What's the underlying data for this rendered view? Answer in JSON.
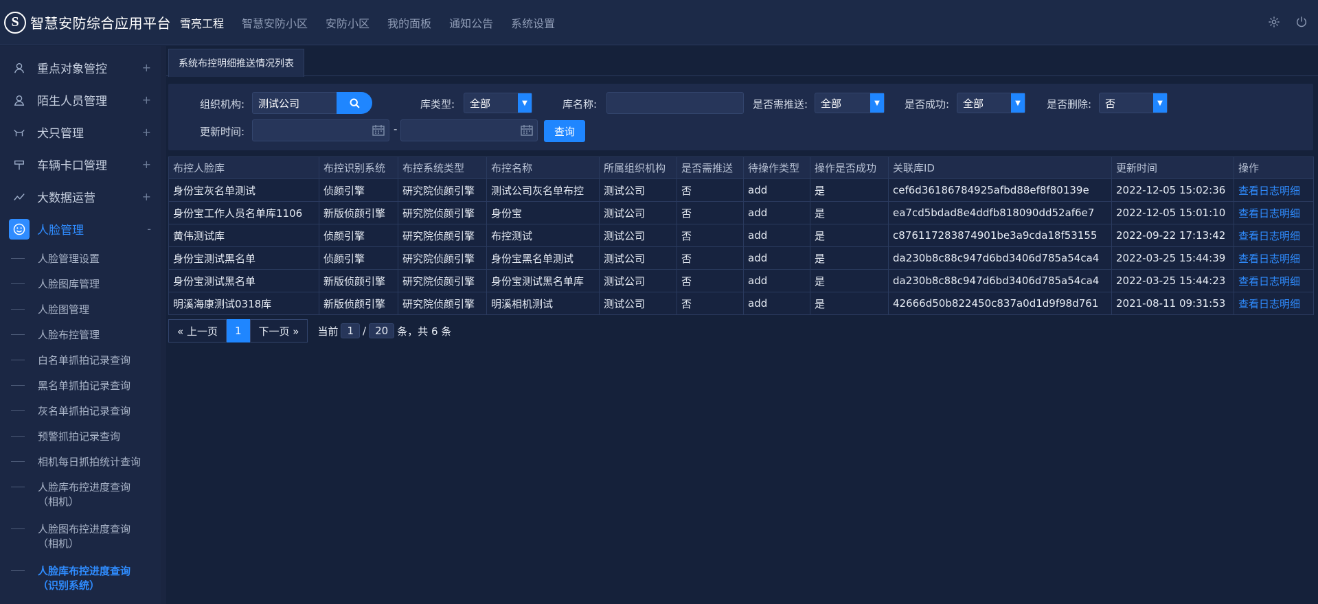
{
  "app": {
    "logo_letter": "S",
    "title": "智慧安防综合应用平台"
  },
  "nav": [
    {
      "label": "雪亮工程",
      "active": true
    },
    {
      "label": "智慧安防小区"
    },
    {
      "label": "安防小区"
    },
    {
      "label": "我的面板"
    },
    {
      "label": "通知公告"
    },
    {
      "label": "系统设置"
    }
  ],
  "top_icons": [
    "gear-icon",
    "power-icon"
  ],
  "sidebar": {
    "items": [
      {
        "label": "重点对象管控",
        "icon": "person-icon",
        "expand": "+"
      },
      {
        "label": "陌生人员管理",
        "icon": "person-outline-icon",
        "expand": "+"
      },
      {
        "label": "犬只管理",
        "icon": "dog-icon",
        "expand": "+"
      },
      {
        "label": "车辆卡口管理",
        "icon": "checkpoint-icon",
        "expand": "+"
      },
      {
        "label": "大数据运营",
        "icon": "trend-icon",
        "expand": "+"
      },
      {
        "label": "人脸管理",
        "icon": "face-icon",
        "expand": "-",
        "active": true
      }
    ],
    "subitems": [
      {
        "label": "人脸管理设置"
      },
      {
        "label": "人脸图库管理"
      },
      {
        "label": "人脸图管理"
      },
      {
        "label": "人脸布控管理"
      },
      {
        "label": "白名单抓拍记录查询"
      },
      {
        "label": "黑名单抓拍记录查询"
      },
      {
        "label": "灰名单抓拍记录查询"
      },
      {
        "label": "预警抓拍记录查询"
      },
      {
        "label": "相机每日抓拍统计查询"
      },
      {
        "label": "人脸库布控进度查询",
        "label2": "（相机）"
      },
      {
        "label": "人脸图布控进度查询",
        "label2": "（相机）"
      },
      {
        "label": "人脸库布控进度查询",
        "label2": "（识别系统）",
        "active": true
      }
    ]
  },
  "tab": {
    "label": "系统布控明细推送情况列表"
  },
  "filters": {
    "org_label": "组织机构:",
    "org_value": "测试公司",
    "lib_type_label": "库类型:",
    "lib_type_value": "全部",
    "lib_name_label": "库名称:",
    "lib_name_value": "",
    "need_push_label": "是否需推送:",
    "need_push_value": "全部",
    "success_label": "是否成功:",
    "success_value": "全部",
    "deleted_label": "是否删除:",
    "deleted_value": "否",
    "update_time_label": "更新时间:",
    "date_sep": "-",
    "query_label": "查询"
  },
  "table": {
    "headers": [
      "布控人脸库",
      "布控识别系统",
      "布控系统类型",
      "布控名称",
      "所属组织机构",
      "是否需推送",
      "待操作类型",
      "操作是否成功",
      "关联库ID",
      "更新时间",
      "操作"
    ],
    "rows": [
      [
        "身份宝灰名单测试",
        "侦颜引擎",
        "研究院侦颜引擎",
        "测试公司灰名单布控",
        "测试公司",
        "否",
        "add",
        "是",
        "cef6d36186784925afbd88ef8f80139e",
        "2022-12-05 15:02:36",
        "查看日志明细"
      ],
      [
        "身份宝工作人员名单库1106",
        "新版侦颜引擎",
        "研究院侦颜引擎",
        "身份宝",
        "测试公司",
        "否",
        "add",
        "是",
        "ea7cd5bdad8e4ddfb818090dd52af6e7",
        "2022-12-05 15:01:10",
        "查看日志明细"
      ],
      [
        "黄伟测试库",
        "侦颜引擎",
        "研究院侦颜引擎",
        "布控测试",
        "测试公司",
        "否",
        "add",
        "是",
        "c876117283874901be3a9cda18f53155",
        "2022-09-22 17:13:42",
        "查看日志明细"
      ],
      [
        "身份宝测试黑名单",
        "侦颜引擎",
        "研究院侦颜引擎",
        "身份宝黑名单测试",
        "测试公司",
        "否",
        "add",
        "是",
        "da230b8c88c947d6bd3406d785a54ca4",
        "2022-03-25 15:44:39",
        "查看日志明细"
      ],
      [
        "身份宝测试黑名单",
        "新版侦颜引擎",
        "研究院侦颜引擎",
        "身份宝测试黑名单库",
        "测试公司",
        "否",
        "add",
        "是",
        "da230b8c88c947d6bd3406d785a54ca4",
        "2022-03-25 15:44:23",
        "查看日志明细"
      ],
      [
        "明溪海康测试0318库",
        "新版侦颜引擎",
        "研究院侦颜引擎",
        "明溪相机测试",
        "测试公司",
        "否",
        "add",
        "是",
        "42666d50b822450c837a0d1d9f98d761",
        "2021-08-11 09:31:53",
        "查看日志明细"
      ]
    ]
  },
  "pagination": {
    "prev": "« 上一页",
    "current": "1",
    "next": "下一页 »",
    "info_prefix": "当前",
    "page": "1",
    "slash": "/",
    "page_size": "20",
    "info_suffix": "条，共 6 条"
  }
}
